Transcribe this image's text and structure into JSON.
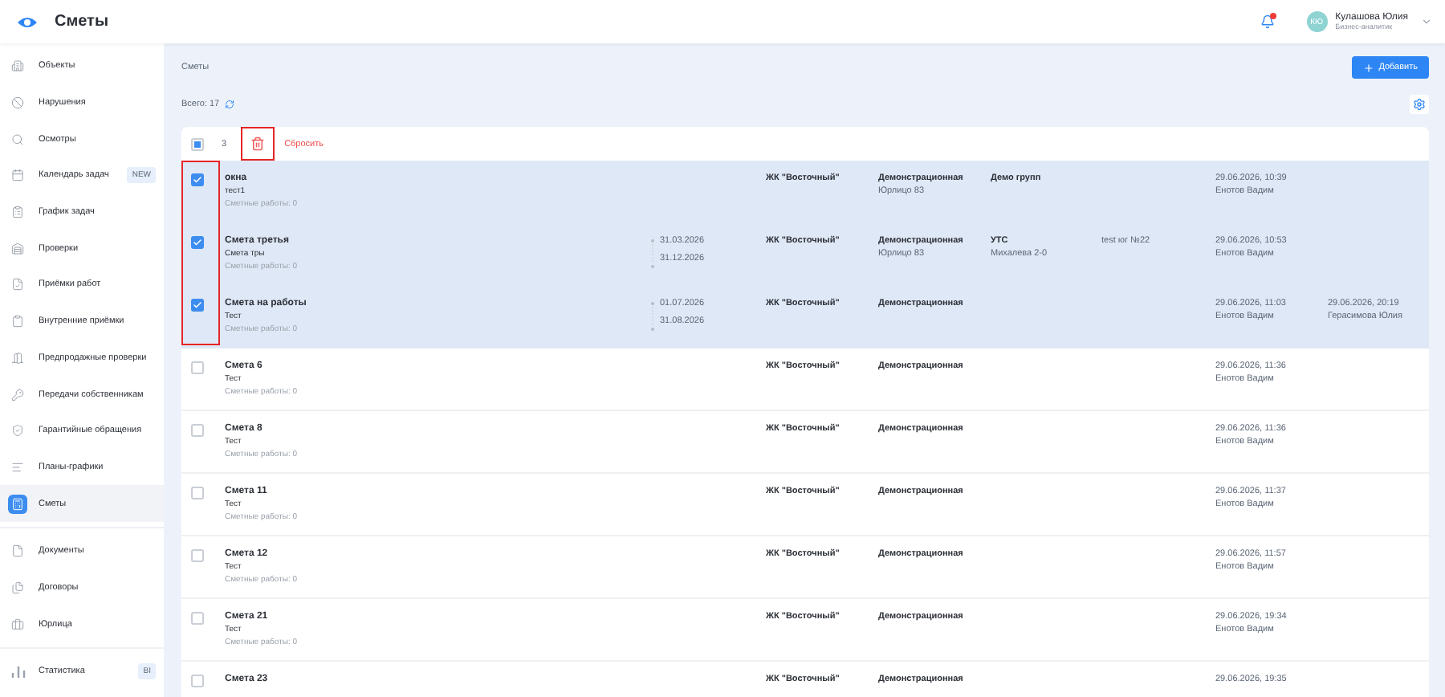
{
  "header": {
    "title": "Сметы",
    "user": {
      "initials": "КЮ",
      "name": "Кулашова Юлия",
      "role": "Бизнес-аналитик"
    },
    "notifications": {
      "unread": true
    }
  },
  "sidebar": {
    "sections": [
      [
        {
          "label": "Объекты",
          "selected": false
        },
        {
          "label": "Нарушения",
          "selected": false
        },
        {
          "label": "Осмотры",
          "selected": false
        },
        {
          "label": "Календарь задач",
          "selected": false,
          "badge": "NEW"
        },
        {
          "label": "График задач",
          "selected": false
        },
        {
          "label": "Проверки",
          "selected": false
        },
        {
          "label": "Приёмки работ",
          "selected": false
        },
        {
          "label": "Внутренние приёмки",
          "selected": false
        },
        {
          "label": "Предпродажные проверки",
          "selected": false
        },
        {
          "label": "Передачи собственникам",
          "selected": false
        },
        {
          "label": "Гарантийные обращения",
          "selected": false
        },
        {
          "label": "Планы-графики",
          "selected": false
        },
        {
          "label": "Сметы",
          "selected": true
        }
      ],
      [
        {
          "label": "Документы",
          "selected": false
        },
        {
          "label": "Договоры",
          "selected": false
        },
        {
          "label": "Юрлица",
          "selected": false
        }
      ],
      [
        {
          "label": "Статистика",
          "selected": false,
          "badge": "BI"
        }
      ]
    ]
  },
  "breadcrumb": "Сметы",
  "add_button": "Добавить",
  "total": "Всего: 17",
  "toolbar": {
    "select_all": {
      "indeterminate": true
    },
    "selected_count": "3",
    "reset": "Сбросить"
  },
  "rows": [
    {
      "selected": true,
      "name": "окна",
      "subtitle": "тест1",
      "works": "Сметные работы: 0",
      "complex": "ЖК \"Восточный\"",
      "org": "Демонстрационная",
      "org_sub": "Юрлицо 83",
      "group": "Демо групп",
      "created": "29.06.2026, 10:39",
      "created_by": "Енотов Вадим"
    },
    {
      "selected": true,
      "name": "Смета третья",
      "subtitle": "Смета тры",
      "works": "Сметные работы: 0",
      "date_from": "31.03.2026",
      "date_to": "31.12.2026",
      "complex": "ЖК \"Восточный\"",
      "org": "Демонстрационная",
      "org_sub": "Юрлицо 83",
      "group": "УТС",
      "group_sub": "Михалева 2-0",
      "test": "test юг №22",
      "created": "29.06.2026, 10:53",
      "created_by": "Енотов Вадим"
    },
    {
      "selected": true,
      "name": "Смета на работы",
      "subtitle": "Тест",
      "works": "Сметные работы: 0",
      "date_from": "01.07.2026",
      "date_to": "31.08.2026",
      "complex": "ЖК \"Восточный\"",
      "org": "Демонстрационная",
      "created": "29.06.2026, 11:03",
      "created_by": "Енотов Вадим",
      "updated": "29.06.2026, 20:19",
      "updated_by": "Герасимова Юлия"
    },
    {
      "selected": false,
      "name": "Смета 6",
      "subtitle": "Тест",
      "works": "Сметные работы: 0",
      "complex": "ЖК \"Восточный\"",
      "org": "Демонстрационная",
      "created": "29.06.2026, 11:36",
      "created_by": "Енотов Вадим"
    },
    {
      "selected": false,
      "name": "Смета 8",
      "subtitle": "Тест",
      "works": "Сметные работы: 0",
      "complex": "ЖК \"Восточный\"",
      "org": "Демонстрационная",
      "created": "29.06.2026, 11:36",
      "created_by": "Енотов Вадим"
    },
    {
      "selected": false,
      "name": "Смета 11",
      "subtitle": "Тест",
      "works": "Сметные работы: 0",
      "complex": "ЖК \"Восточный\"",
      "org": "Демонстрационная",
      "created": "29.06.2026, 11:37",
      "created_by": "Енотов Вадим"
    },
    {
      "selected": false,
      "name": "Смета 12",
      "subtitle": "Тест",
      "works": "Сметные работы: 0",
      "complex": "ЖК \"Восточный\"",
      "org": "Демонстрационная",
      "created": "29.06.2026, 11:57",
      "created_by": "Енотов Вадим"
    },
    {
      "selected": false,
      "name": "Смета 21",
      "subtitle": "Тест",
      "works": "Сметные работы: 0",
      "complex": "ЖК \"Восточный\"",
      "org": "Демонстрационная",
      "created": "29.06.2026, 19:34",
      "created_by": "Енотов Вадим"
    },
    {
      "selected": false,
      "name": "Смета 23",
      "complex": "ЖК \"Восточный\"",
      "org": "Демонстрационная",
      "created": "29.06.2026, 19:35"
    }
  ]
}
